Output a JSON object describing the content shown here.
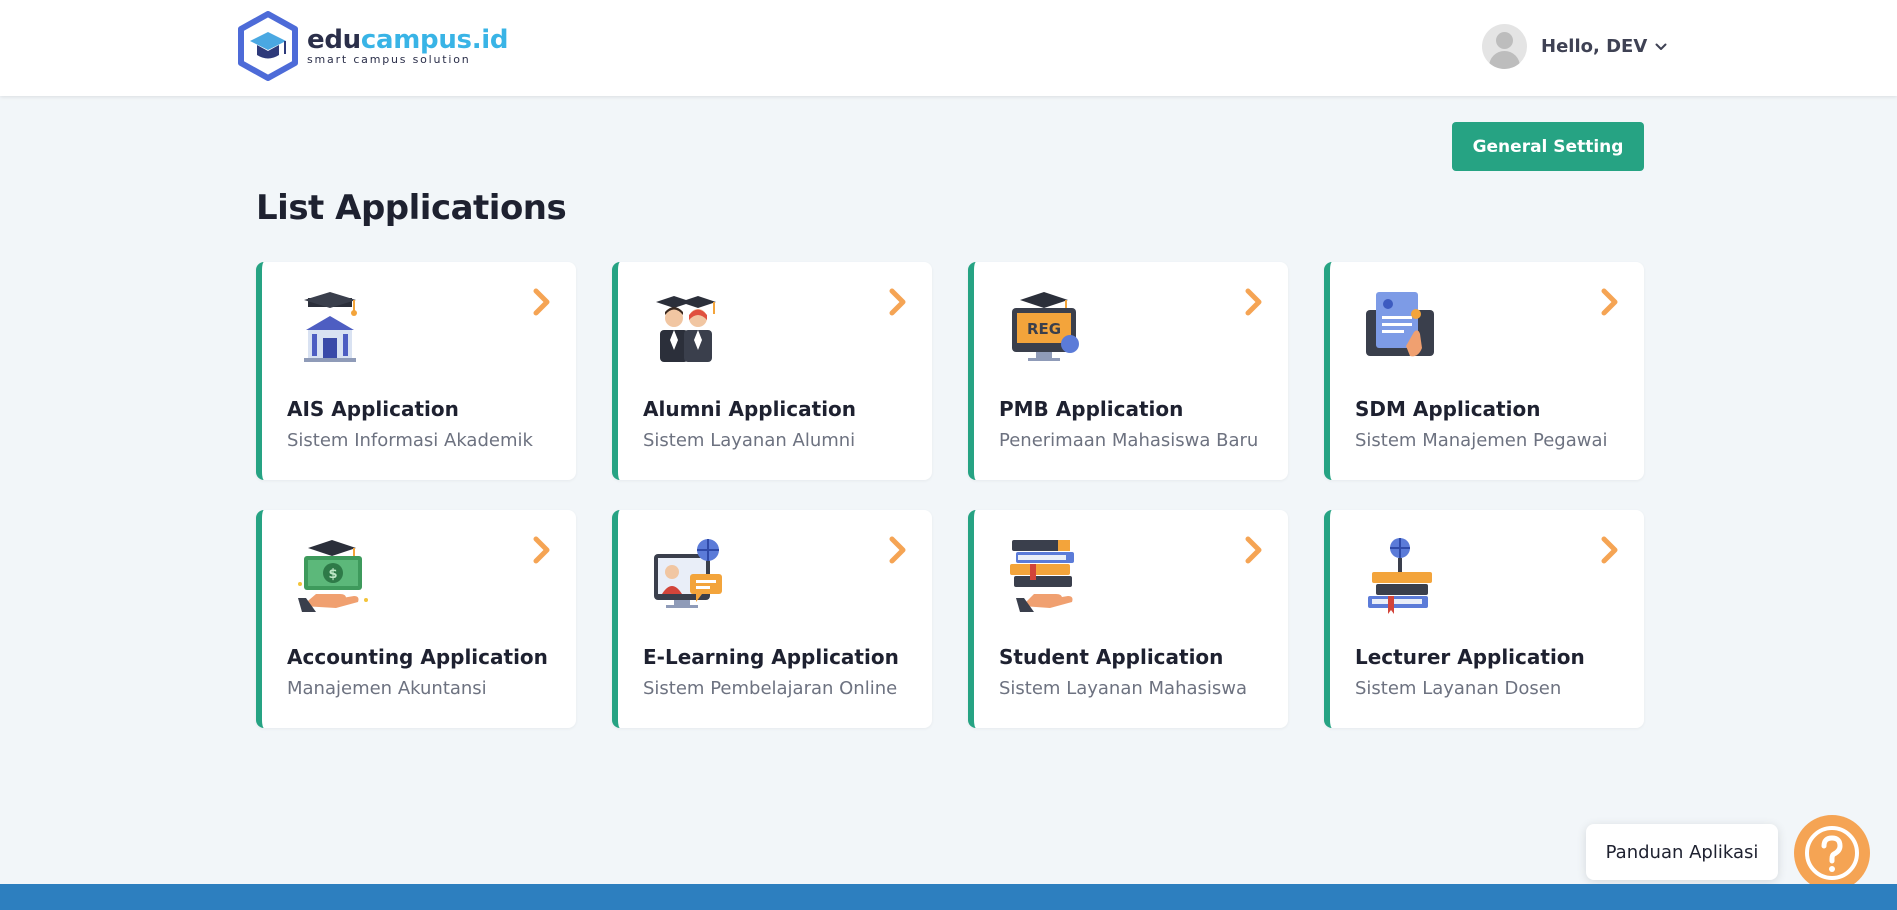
{
  "brand": {
    "name_part1": "edu",
    "name_part2": "campus.id",
    "tagline": "smart campus solution"
  },
  "user": {
    "greeting": "Hello, DEV"
  },
  "actions": {
    "general_setting": "General Setting"
  },
  "page": {
    "title": "List Applications"
  },
  "apps": [
    {
      "name": "AIS Application",
      "desc": "Sistem Informasi Akademik",
      "icon": "campus-building-icon"
    },
    {
      "name": "Alumni Application",
      "desc": "Sistem Layanan Alumni",
      "icon": "graduates-icon"
    },
    {
      "name": "PMB Application",
      "desc": "Penerimaan Mahasiswa Baru",
      "icon": "registration-monitor-icon"
    },
    {
      "name": "SDM Application",
      "desc": "Sistem Manajemen Pegawai",
      "icon": "employee-document-icon"
    },
    {
      "name": "Accounting Application",
      "desc": "Manajemen Akuntansi",
      "icon": "money-hand-icon"
    },
    {
      "name": "E-Learning Application",
      "desc": "Sistem Pembelajaran Online",
      "icon": "online-teacher-icon"
    },
    {
      "name": "Student Application",
      "desc": "Sistem Layanan Mahasiswa",
      "icon": "books-hand-icon"
    },
    {
      "name": "Lecturer Application",
      "desc": "Sistem Layanan Dosen",
      "icon": "books-globe-icon"
    }
  ],
  "help": {
    "label": "Panduan Aplikasi"
  },
  "colors": {
    "accent": "#26a383",
    "arrow": "#f5a454",
    "footer": "#2d7fbf",
    "brand_blue": "#39b4e6"
  }
}
